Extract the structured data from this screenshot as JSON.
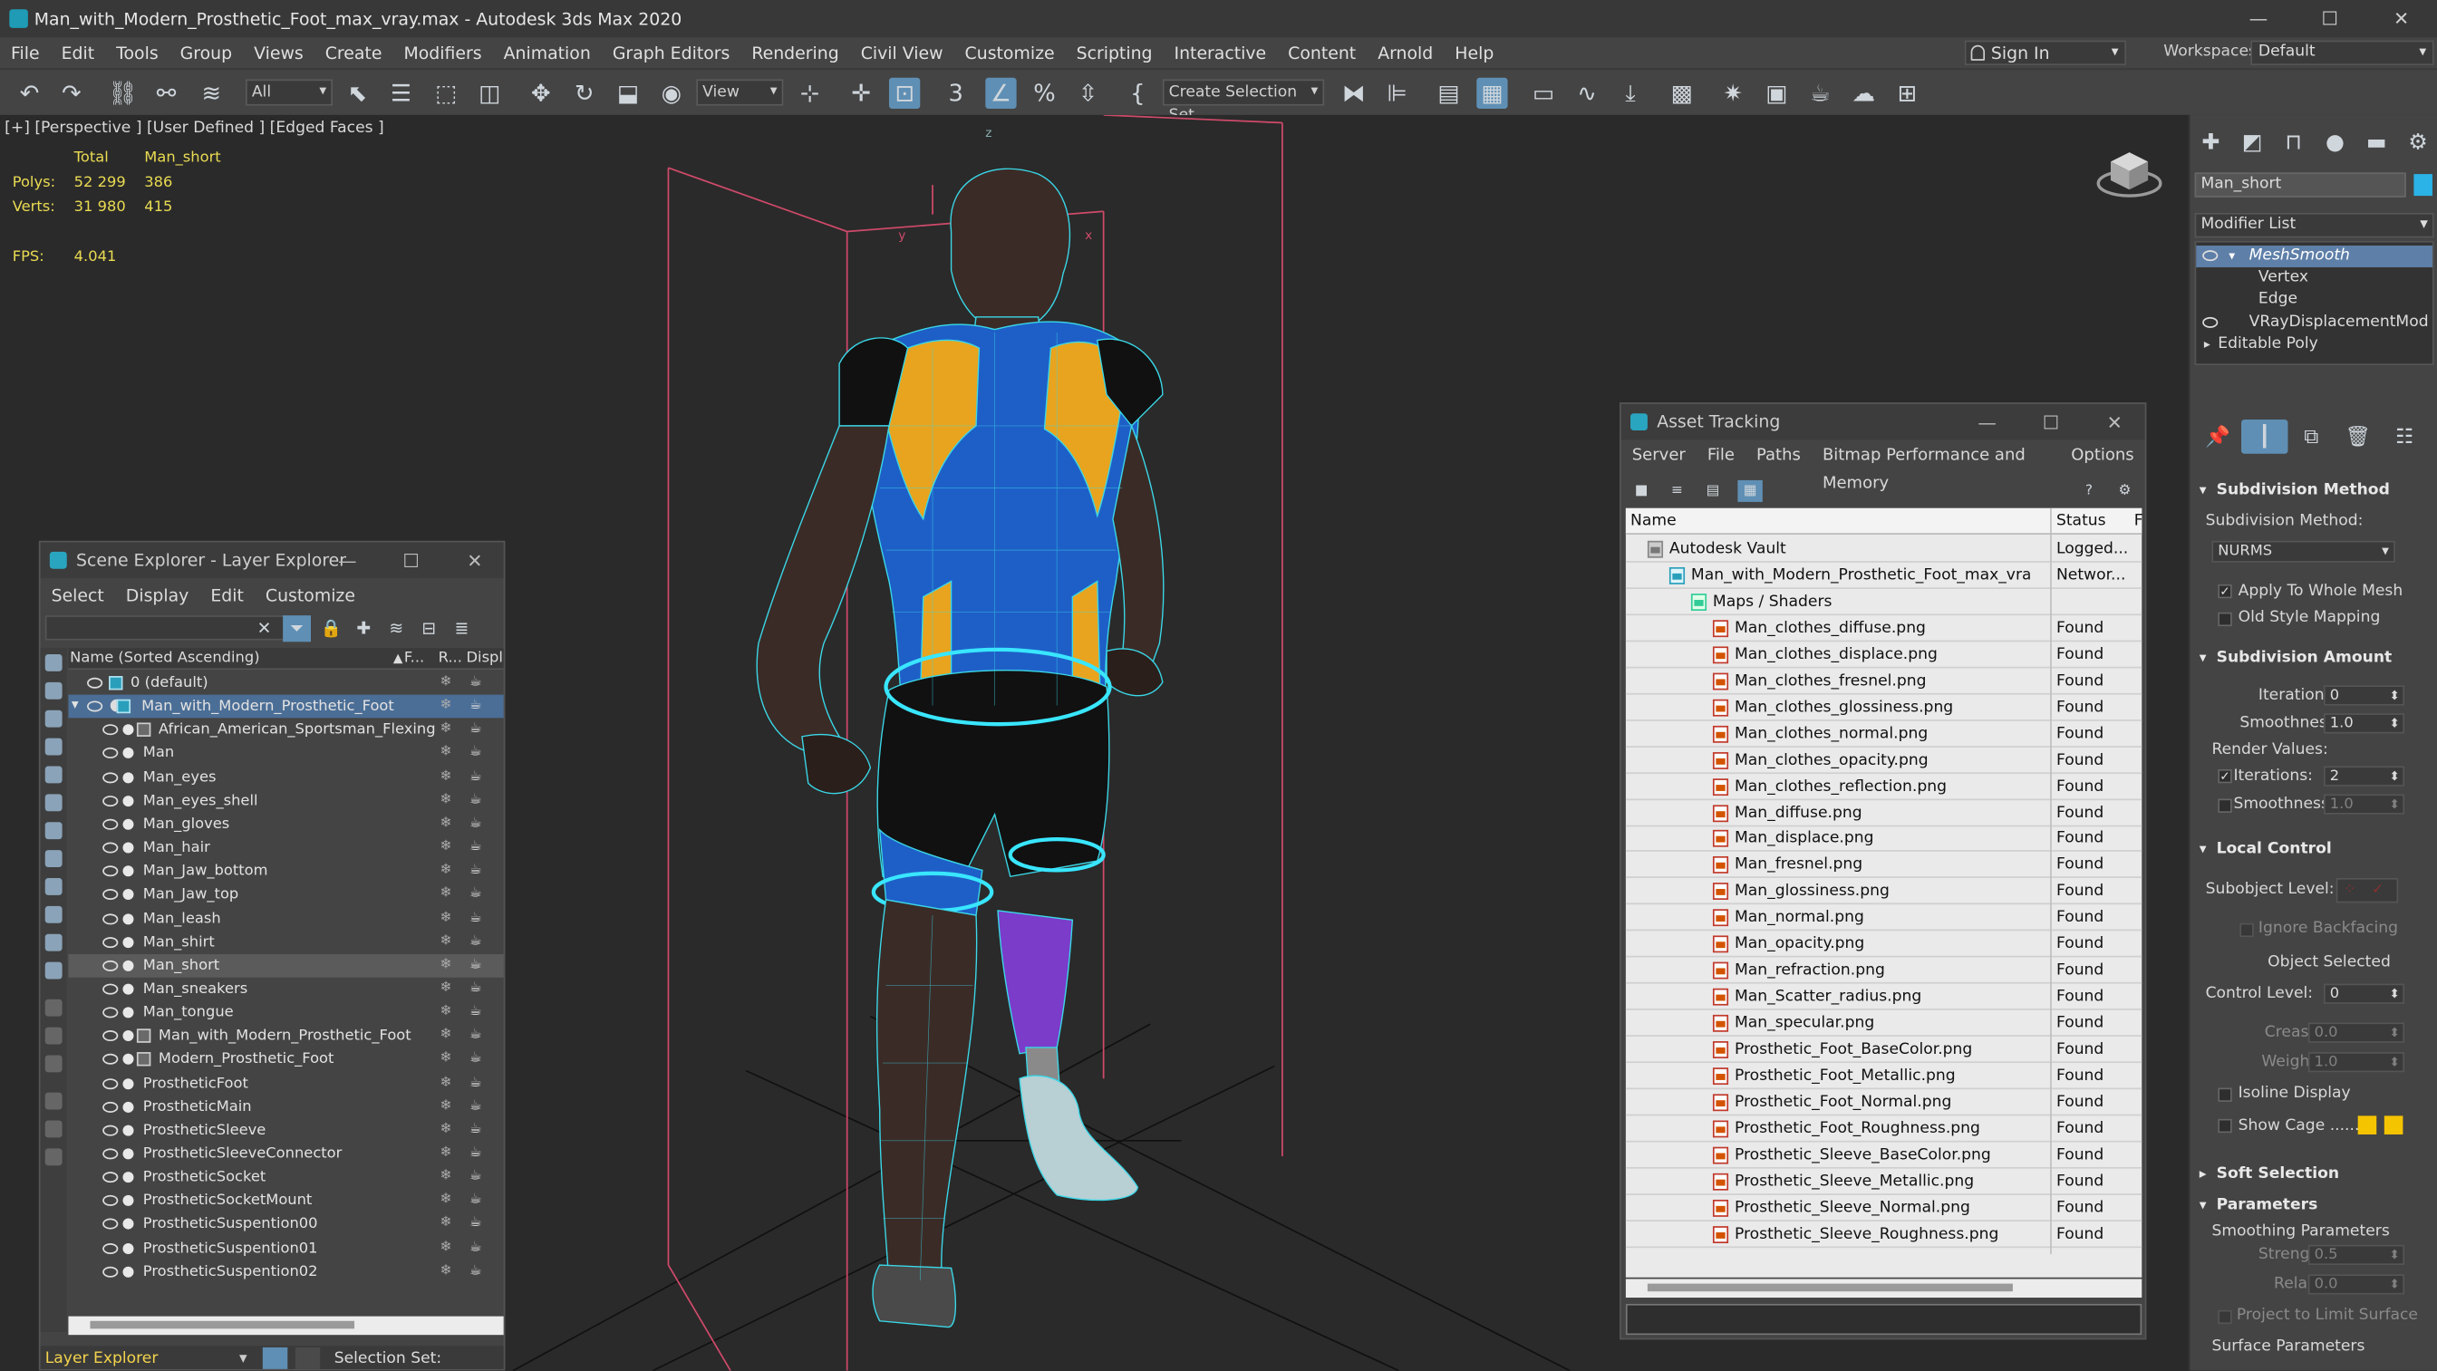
{
  "window": {
    "title": "Man_with_Modern_Prosthetic_Foot_max_vray.max - Autodesk 3ds Max 2020"
  },
  "menu": [
    "File",
    "Edit",
    "Tools",
    "Group",
    "Views",
    "Create",
    "Modifiers",
    "Animation",
    "Graph Editors",
    "Rendering",
    "Civil View",
    "Customize",
    "Scripting",
    "Interactive",
    "Content",
    "Arnold",
    "Help"
  ],
  "account": {
    "sign_in": "Sign In",
    "workspaces_label": "Workspaces:",
    "workspace": "Default"
  },
  "toolbar": {
    "filter": "All",
    "ref_coord": "View",
    "selection_set": "Create Selection Set"
  },
  "viewport": {
    "label": "[+] [Perspective ] [User Defined ] [Edged Faces ]",
    "stats_headers": [
      "Total",
      "Man_short"
    ],
    "stats": [
      {
        "label": "Polys:",
        "total": "52 299",
        "sel": "386"
      },
      {
        "label": "Verts:",
        "total": "31 980",
        "sel": "415"
      }
    ],
    "fps_label": "FPS:",
    "fps": "4.041",
    "gizmo_z": "z",
    "gizmo_x": "x",
    "gizmo_y": "y"
  },
  "command_panel": {
    "object_name": "Man_short",
    "modifier_list": "Modifier List",
    "stack": [
      "MeshSmooth",
      "Vertex",
      "Edge",
      "VRayDisplacementMod",
      "Editable Poly"
    ],
    "subdivision_method": {
      "title": "Subdivision Method",
      "label": "Subdivision Method:",
      "value": "NURMS",
      "apply_whole": "Apply To Whole Mesh",
      "old_style": "Old Style Mapping"
    },
    "subdivision_amount": {
      "title": "Subdivision Amount",
      "iterations_label": "Iterations:",
      "iterations": "0",
      "smoothness_label": "Smoothness:",
      "smoothness": "1.0",
      "render_values": "Render Values:",
      "r_iterations_label": "Iterations:",
      "r_iterations": "2",
      "r_smoothness_label": "Smoothness:",
      "r_smoothness": "1.0"
    },
    "local_control": {
      "title": "Local Control",
      "sublevel_label": "Subobject Level:",
      "ignore_backfacing": "Ignore Backfacing",
      "object_selected": "Object Selected",
      "control_level_label": "Control Level:",
      "control_level": "0",
      "crease_label": "Crease:",
      "crease": "0.0",
      "weight_label": "Weight:",
      "weight": "1.0",
      "isoline": "Isoline Display",
      "show_cage": "Show Cage ......"
    },
    "soft_selection": {
      "title": "Soft Selection"
    },
    "parameters": {
      "title": "Parameters",
      "smoothing": "Smoothing Parameters",
      "strength_label": "Strength:",
      "strength": "0.5",
      "relax_label": "Relax:",
      "relax": "0.0",
      "project": "Project to Limit Surface",
      "surface": "Surface Parameters"
    },
    "colors": {
      "cage_a": "#f5c400",
      "cage_b": "#f5c400"
    }
  },
  "scene_explorer": {
    "title": "Scene Explorer - Layer Explorer",
    "menu": [
      "Select",
      "Display",
      "Edit",
      "Customize"
    ],
    "columns": {
      "name": "Name (Sorted Ascending)",
      "frozen": "F...",
      "render": "R...",
      "display": "Displa"
    },
    "rows": [
      {
        "name": "0 (default)",
        "level": 0,
        "type": "layer"
      },
      {
        "name": "Man_with_Modern_Prosthetic_Foot",
        "level": 0,
        "type": "layer",
        "state": "parent"
      },
      {
        "name": "African_American_Sportsman_Flexing",
        "level": 1,
        "type": "group"
      },
      {
        "name": "Man",
        "level": 1,
        "type": "obj"
      },
      {
        "name": "Man_eyes",
        "level": 1,
        "type": "obj"
      },
      {
        "name": "Man_eyes_shell",
        "level": 1,
        "type": "obj"
      },
      {
        "name": "Man_gloves",
        "level": 1,
        "type": "obj"
      },
      {
        "name": "Man_hair",
        "level": 1,
        "type": "obj"
      },
      {
        "name": "Man_Jaw_bottom",
        "level": 1,
        "type": "obj"
      },
      {
        "name": "Man_Jaw_top",
        "level": 1,
        "type": "obj"
      },
      {
        "name": "Man_leash",
        "level": 1,
        "type": "obj"
      },
      {
        "name": "Man_shirt",
        "level": 1,
        "type": "obj"
      },
      {
        "name": "Man_short",
        "level": 1,
        "type": "obj",
        "state": "selected"
      },
      {
        "name": "Man_sneakers",
        "level": 1,
        "type": "obj"
      },
      {
        "name": "Man_tongue",
        "level": 1,
        "type": "obj"
      },
      {
        "name": "Man_with_Modern_Prosthetic_Foot",
        "level": 1,
        "type": "group"
      },
      {
        "name": "Modern_Prosthetic_Foot",
        "level": 1,
        "type": "group"
      },
      {
        "name": "ProstheticFoot",
        "level": 1,
        "type": "obj"
      },
      {
        "name": "ProstheticMain",
        "level": 1,
        "type": "obj"
      },
      {
        "name": "ProstheticSleeve",
        "level": 1,
        "type": "obj"
      },
      {
        "name": "ProstheticSleeveConnector",
        "level": 1,
        "type": "obj"
      },
      {
        "name": "ProstheticSocket",
        "level": 1,
        "type": "obj"
      },
      {
        "name": "ProstheticSocketMount",
        "level": 1,
        "type": "obj"
      },
      {
        "name": "ProstheticSuspention00",
        "level": 1,
        "type": "obj"
      },
      {
        "name": "ProstheticSuspention01",
        "level": 1,
        "type": "obj"
      },
      {
        "name": "ProstheticSuspention02",
        "level": 1,
        "type": "obj"
      }
    ],
    "footer": {
      "explorer": "Layer Explorer",
      "selection_set": "Selection Set:"
    }
  },
  "asset_tracking": {
    "title": "Asset Tracking",
    "menu": [
      "Server",
      "File",
      "Paths",
      "Bitmap Performance and Memory",
      "Options"
    ],
    "columns": {
      "name": "Name",
      "status": "Status",
      "extra": "F"
    },
    "rows": [
      {
        "name": "Autodesk Vault",
        "status": "Logged...",
        "level": 0,
        "kind": "v"
      },
      {
        "name": "Man_with_Modern_Prosthetic_Foot_max_vray.max",
        "status": "Networ...",
        "level": 1,
        "kind": "mx"
      },
      {
        "name": "Maps / Shaders",
        "status": "",
        "level": 2,
        "kind": "fl"
      },
      {
        "name": "Man_clothes_diffuse.png",
        "status": "Found",
        "level": 3,
        "kind": "img"
      },
      {
        "name": "Man_clothes_displace.png",
        "status": "Found",
        "level": 3,
        "kind": "img"
      },
      {
        "name": "Man_clothes_fresnel.png",
        "status": "Found",
        "level": 3,
        "kind": "img"
      },
      {
        "name": "Man_clothes_glossiness.png",
        "status": "Found",
        "level": 3,
        "kind": "img"
      },
      {
        "name": "Man_clothes_normal.png",
        "status": "Found",
        "level": 3,
        "kind": "img"
      },
      {
        "name": "Man_clothes_opacity.png",
        "status": "Found",
        "level": 3,
        "kind": "img"
      },
      {
        "name": "Man_clothes_reflection.png",
        "status": "Found",
        "level": 3,
        "kind": "img"
      },
      {
        "name": "Man_diffuse.png",
        "status": "Found",
        "level": 3,
        "kind": "img"
      },
      {
        "name": "Man_displace.png",
        "status": "Found",
        "level": 3,
        "kind": "img"
      },
      {
        "name": "Man_fresnel.png",
        "status": "Found",
        "level": 3,
        "kind": "img"
      },
      {
        "name": "Man_glossiness.png",
        "status": "Found",
        "level": 3,
        "kind": "img"
      },
      {
        "name": "Man_normal.png",
        "status": "Found",
        "level": 3,
        "kind": "img"
      },
      {
        "name": "Man_opacity.png",
        "status": "Found",
        "level": 3,
        "kind": "img"
      },
      {
        "name": "Man_refraction.png",
        "status": "Found",
        "level": 3,
        "kind": "img"
      },
      {
        "name": "Man_Scatter_radius.png",
        "status": "Found",
        "level": 3,
        "kind": "img"
      },
      {
        "name": "Man_specular.png",
        "status": "Found",
        "level": 3,
        "kind": "img"
      },
      {
        "name": "Prosthetic_Foot_BaseColor.png",
        "status": "Found",
        "level": 3,
        "kind": "img"
      },
      {
        "name": "Prosthetic_Foot_Metallic.png",
        "status": "Found",
        "level": 3,
        "kind": "img"
      },
      {
        "name": "Prosthetic_Foot_Normal.png",
        "status": "Found",
        "level": 3,
        "kind": "img"
      },
      {
        "name": "Prosthetic_Foot_Roughness.png",
        "status": "Found",
        "level": 3,
        "kind": "img"
      },
      {
        "name": "Prosthetic_Sleeve_BaseColor.png",
        "status": "Found",
        "level": 3,
        "kind": "img"
      },
      {
        "name": "Prosthetic_Sleeve_Metallic.png",
        "status": "Found",
        "level": 3,
        "kind": "img"
      },
      {
        "name": "Prosthetic_Sleeve_Normal.png",
        "status": "Found",
        "level": 3,
        "kind": "img"
      },
      {
        "name": "Prosthetic_Sleeve_Roughness.png",
        "status": "Found",
        "level": 3,
        "kind": "img"
      }
    ]
  }
}
